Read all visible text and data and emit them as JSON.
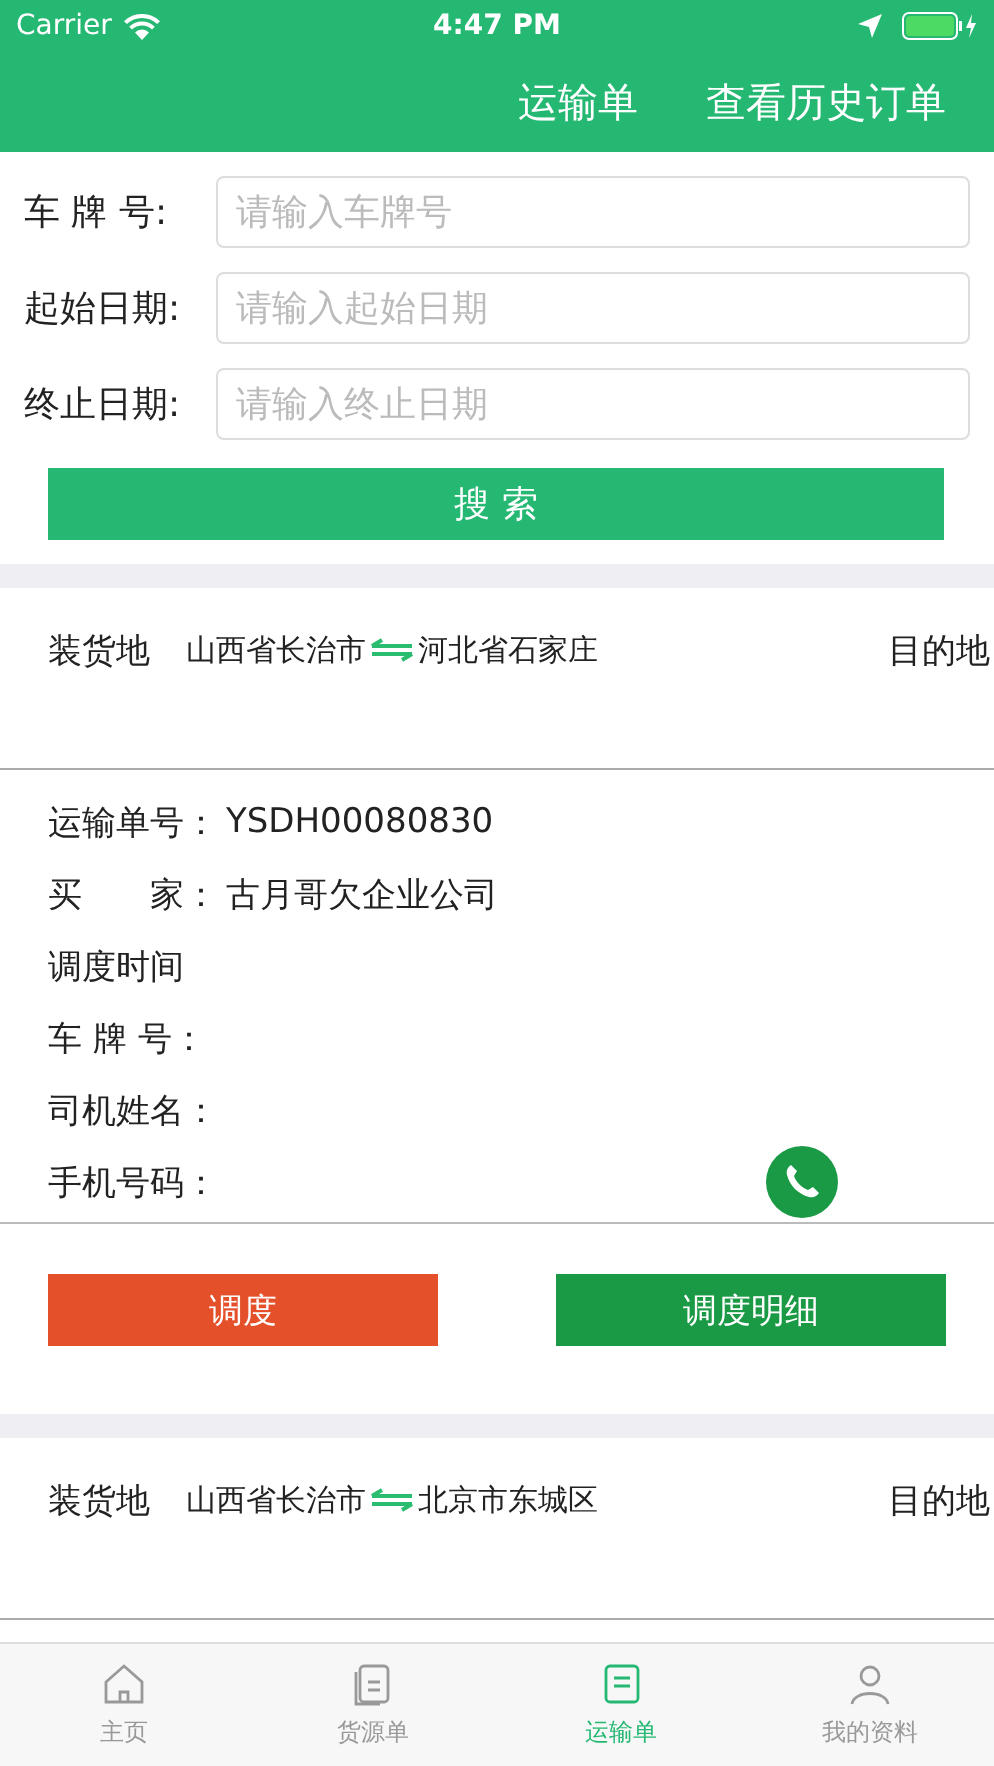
{
  "status_bar": {
    "carrier": "Carrier",
    "time": "4:47 PM"
  },
  "nav": {
    "title": "运输单",
    "action": "查看历史订单"
  },
  "form": {
    "fields": [
      {
        "label": "车 牌 号:",
        "placeholder": "请输入车牌号"
      },
      {
        "label": "起始日期:",
        "placeholder": "请输入起始日期"
      },
      {
        "label": "终止日期:",
        "placeholder": "请输入终止日期"
      }
    ],
    "search_button": "搜 索"
  },
  "orders": [
    {
      "load_label": "装货地",
      "origin": "山西省长治市",
      "destination": "河北省石家庄",
      "dest_label": "目的地",
      "fields": [
        {
          "label": "运输单号：",
          "value": "YSDH00080830"
        },
        {
          "label": "买　　家：",
          "value": "古月哥欠企业公司"
        },
        {
          "label": "调度时间"
        },
        {
          "label": "车 牌 号："
        },
        {
          "label": "司机姓名："
        },
        {
          "label": "手机号码：",
          "call": true
        }
      ],
      "buttons": [
        {
          "label": "调度",
          "kind": "dispatch"
        },
        {
          "label": "调度明细",
          "kind": "details"
        }
      ]
    },
    {
      "load_label": "装货地",
      "origin": "山西省长治市",
      "destination": "北京市东城区",
      "dest_label": "目的地"
    }
  ],
  "tab_bar": [
    {
      "label": "主页",
      "kind": "home",
      "selected": false
    },
    {
      "label": "货源单",
      "kind": "document",
      "selected": false
    },
    {
      "label": "运输单",
      "kind": "list",
      "selected": true
    },
    {
      "label": "我的资料",
      "kind": "person",
      "selected": false
    }
  ]
}
